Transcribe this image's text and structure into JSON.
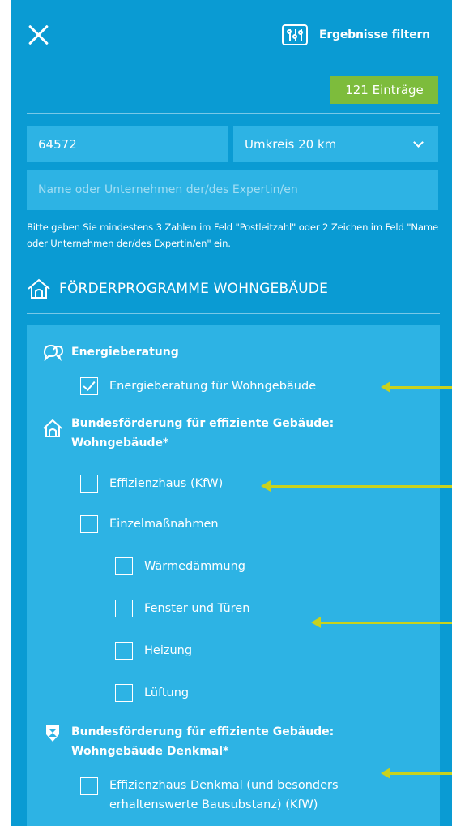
{
  "header": {
    "filter_title": "Ergebnisse filtern",
    "count_badge": "121 Einträge"
  },
  "search": {
    "zip_value": "64572",
    "radius_value": "Umkreis 20 km",
    "name_placeholder": "Name oder Unternehmen der/des Expertin/en",
    "hint": "Bitte geben Sie mindestens 3 Zahlen im Feld \"Postleitzahl\" oder 2 Zeichen im Feld \"Name oder Unternehmen der/des Expertin/en\" ein."
  },
  "section": {
    "title": "FÖRDERPROGRAMME WOHNGEBÄUDE"
  },
  "groups": [
    {
      "title": "Energieberatung",
      "icon": "speech-bubbles-icon",
      "options": [
        {
          "label": "Energieberatung für Wohngebäude",
          "checked": true
        }
      ]
    },
    {
      "title_line1": "Bundesförderung für effiziente Gebäude:",
      "title_line2": "Wohngebäude*",
      "icon": "house-icon",
      "options": [
        {
          "label": "Effizienzhaus (KfW)",
          "checked": false
        },
        {
          "label": "Einzelmaßnahmen",
          "checked": false
        }
      ],
      "sub_options": [
        {
          "label": "Wärmedämmung",
          "checked": false
        },
        {
          "label": "Fenster und Türen",
          "checked": false
        },
        {
          "label": "Heizung",
          "checked": false
        },
        {
          "label": "Lüftung",
          "checked": false
        }
      ]
    },
    {
      "title_line1": "Bundesförderung für effiziente Gebäude:",
      "title_line2": "Wohngebäude Denkmal*",
      "icon": "monument-badge-icon",
      "options": [
        {
          "label_line1": "Effizienzhaus Denkmal (und besonders",
          "label_line2": "erhaltenswerte Bausubstanz) (KfW)",
          "checked": false
        }
      ]
    }
  ],
  "colors": {
    "background": "#0a9bd3",
    "field": "#2db3e4",
    "badge": "#7dbc3c",
    "annotation_arrow": "#c8d21e"
  }
}
